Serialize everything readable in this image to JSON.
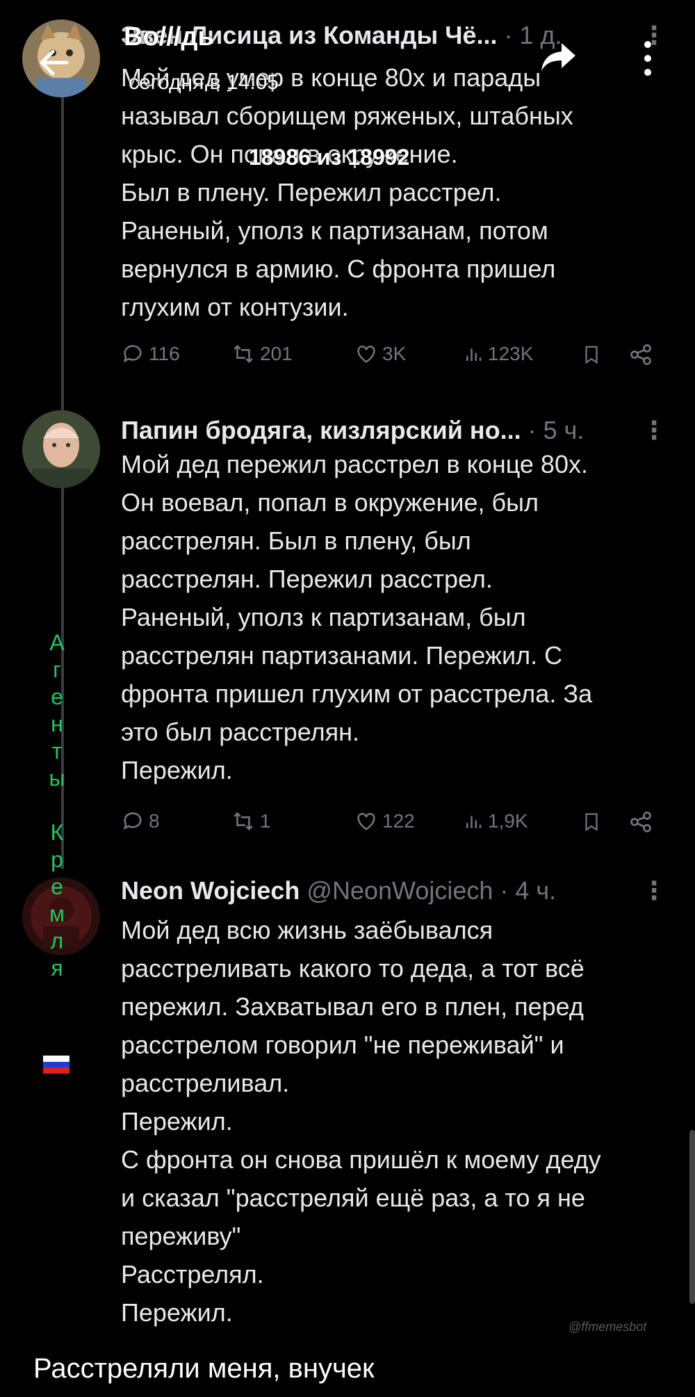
{
  "top_bar": {
    "title": "Bo///дь",
    "subtitle": "сегодня в 14:05",
    "counter": "18986 из 18992"
  },
  "tweets": [
    {
      "name": "Эвен Лисица из Команды Чё...",
      "meta": " · 1 д.",
      "more": "⋮",
      "body": "Мой дед умер в конце 80х и парады\nназывал сборищем ряженых, штабных\nкрыс. Он попал в окружение.\nБыл в плену. Пережил расстрел.\nРаненый, уполз к партизанам, потом\nвернулся в армию. С фронта пришел\nглухим от контузии.",
      "replies": "116",
      "reposts": "201",
      "likes": "3K",
      "views": "123K"
    },
    {
      "name": "Папин бродяга, кизлярский но...",
      "meta": " · 5 ч.",
      "more": "⋮",
      "body": "Мой дед пережил расстрел в конце 80х.\nОн воевал, попал в окружение, был\nрасстрелян. Был в плену, был\nрасстрелян. Пережил расстрел.\nРаненый, уполз к партизанам, был\nрасстрелян партизанами. Пережил. С\nфронта пришел глухим от расстрела. За\nэто был расстрелян.\nПережил.",
      "replies": "8",
      "reposts": "1",
      "likes": "122",
      "views": "1,9K"
    },
    {
      "name": "Neon Wojciech",
      "handle": " @NeonWojciech",
      "meta": " · 4 ч.",
      "more": "⋮",
      "body": "Мой дед всю жизнь заёбывался\nрасстреливать какого то деда, а тот всё\nпережил. Захватывал его в плен, перед\nрасстрелом говорил \"не переживай\" и\nрасстреливал.\nПережил.\nС фронта он снова пришёл к моему деду\nи сказал \"расстреляй ещё раз, а то я не\nпереживу\"\nРасстрелял.\nПережил."
    }
  ],
  "side_label": {
    "letters": [
      "А",
      "г",
      "е",
      "н",
      "т",
      "ы",
      "",
      "К",
      "р",
      "е",
      "м",
      "л",
      "я"
    ],
    "color": "#22c55e",
    "flag_colors": [
      "#ffffff",
      "#1c3fd1",
      "#e02020"
    ]
  },
  "icons": [
    "back-arrow-icon",
    "share-icon",
    "more-icon",
    "reply-icon",
    "repost-icon",
    "like-icon",
    "views-icon",
    "bookmark-icon",
    "share-node-icon"
  ],
  "watermark": "@ffmemesbot",
  "caption": "Расстреляли меня, внучек"
}
